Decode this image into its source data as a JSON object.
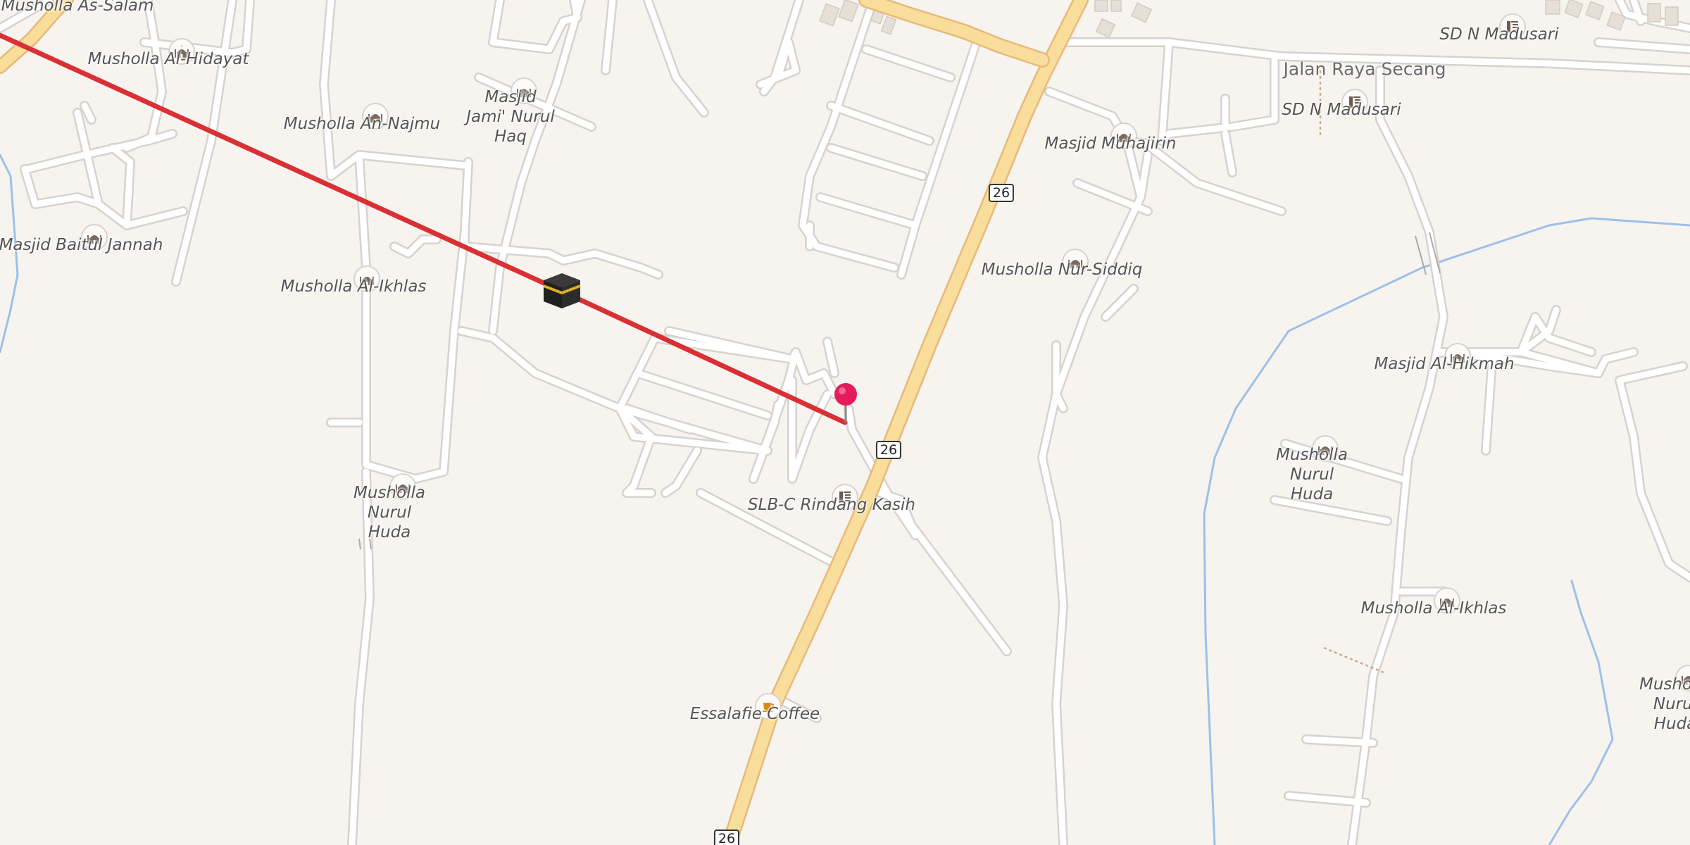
{
  "map": {
    "route_color": "#d93035",
    "highway_color": "#f9dd9a",
    "highway_casing": "#e8b87a",
    "road_color": "#ffffff",
    "road_casing": "#d6d2cd",
    "water_color": "#9dc0e8",
    "background": "#f7f4f0"
  },
  "pois": [
    {
      "label": "Musholla As-Salam",
      "icon": "mosque-icon"
    },
    {
      "label": "Musholla Al-Hidayat",
      "icon": "mosque-icon"
    },
    {
      "label": "Musholla An-Najmu",
      "icon": "mosque-icon"
    },
    {
      "label": "Masjid Jami' Nurul Haq",
      "icon": "mosque-icon"
    },
    {
      "label": "Masjid Baitul Jannah",
      "icon": "mosque-icon"
    },
    {
      "label": "Musholla Al-Ikhlas",
      "icon": "mosque-icon"
    },
    {
      "label": "Musholla Nurul Huda",
      "icon": "mosque-icon"
    },
    {
      "label": "SLB-C Rindang Kasih",
      "icon": "school-icon"
    },
    {
      "label": "Essalafie Coffee",
      "icon": "cafe-icon"
    },
    {
      "label": "Masjid Muhajirin",
      "icon": "mosque-icon"
    },
    {
      "label": "Musholla Nur-Siddiq",
      "icon": "mosque-icon"
    },
    {
      "label": "SD N Madusari",
      "icon": "school-icon"
    },
    {
      "label": "SD N Madusari",
      "icon": "school-icon"
    },
    {
      "label": "Masjid Al-Hikmah",
      "icon": "mosque-icon"
    },
    {
      "label": "Musholla Nurul Huda",
      "icon": "mosque-icon"
    },
    {
      "label": "Musholla Al-Ikhlas",
      "icon": "mosque-icon"
    },
    {
      "label": "Musholla Nurul Huda",
      "icon": "mosque-icon"
    }
  ],
  "streets": [
    {
      "label": "Jalan Raya Secang"
    }
  ],
  "route_shields": [
    "26",
    "26",
    "26"
  ],
  "markers": {
    "kaaba": {
      "icon": "kaaba-icon"
    },
    "pin": {
      "icon": "map-pin-icon"
    }
  }
}
